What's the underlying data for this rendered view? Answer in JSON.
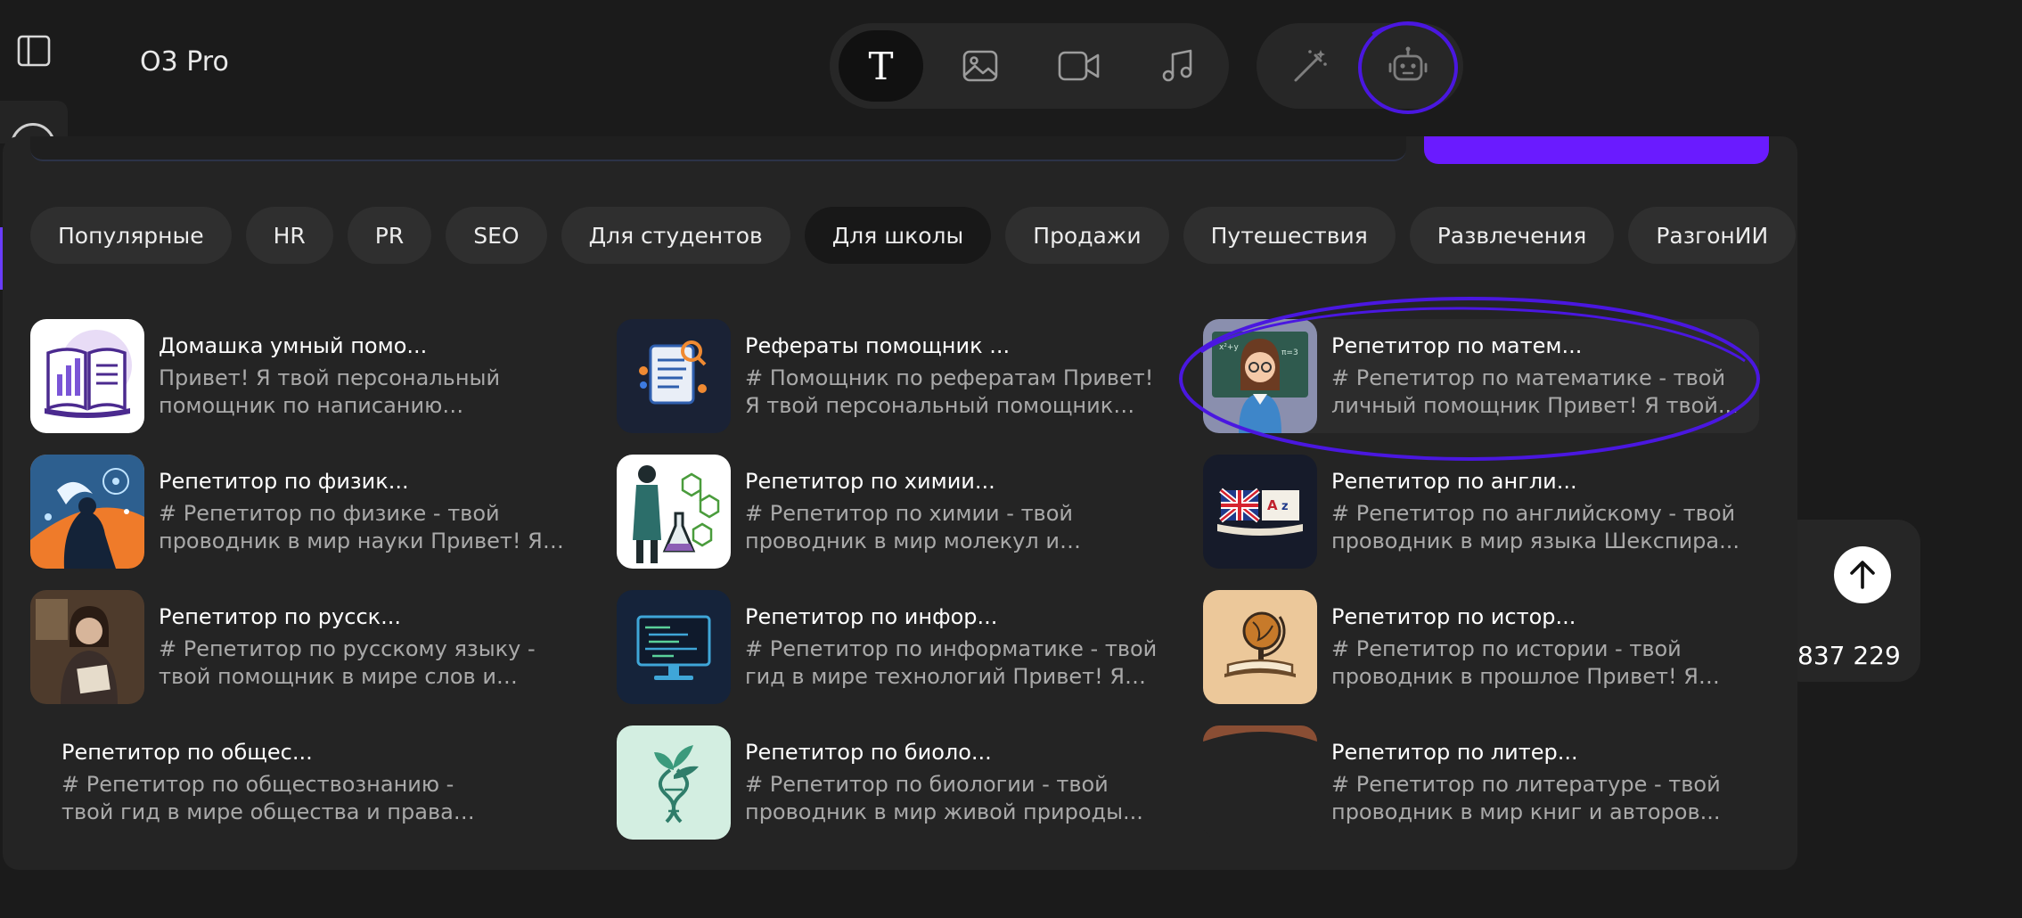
{
  "header": {
    "title": "O3 Pro"
  },
  "modes": [
    {
      "name": "text",
      "icon": "text-mode-icon",
      "active": true,
      "glyph": "T"
    },
    {
      "name": "image",
      "icon": "image-icon",
      "active": false
    },
    {
      "name": "video",
      "icon": "video-icon",
      "active": false
    },
    {
      "name": "music",
      "icon": "music-icon",
      "active": false
    }
  ],
  "tools": [
    {
      "name": "magic",
      "icon": "magic-wand-icon"
    },
    {
      "name": "bot",
      "icon": "robot-icon"
    }
  ],
  "side_widget": {
    "counter": "837 229"
  },
  "chips": [
    {
      "label": "Популярные",
      "active": false
    },
    {
      "label": "HR",
      "active": false
    },
    {
      "label": "PR",
      "active": false
    },
    {
      "label": "SEO",
      "active": false
    },
    {
      "label": "Для студентов",
      "active": false
    },
    {
      "label": "Для школы",
      "active": true
    },
    {
      "label": "Продажи",
      "active": false
    },
    {
      "label": "Путешествия",
      "active": false
    },
    {
      "label": "Развлечения",
      "active": false
    },
    {
      "label": "РазгонИИ",
      "active": false
    }
  ],
  "cards": [
    {
      "title": "Домашка умный помо...",
      "desc": "Привет! Я твой персональный помощник по написанию рефератов..."
    },
    {
      "title": "Рефераты помощник ...",
      "desc": "# Помощник по рефератам Привет! Я твой персональный помощник по..."
    },
    {
      "title": "Репетитор по матем...",
      "desc": "# Репетитор по математике - твой личный помощник Привет! Я твой..."
    },
    {
      "title": "Репетитор по физик...",
      "desc": "# Репетитор по физике - твой проводник в мир науки Привет! Я тво..."
    },
    {
      "title": "Репетитор по химии...",
      "desc": "# Репетитор по химии - твой проводник в мир молекул и реакций..."
    },
    {
      "title": "Репетитор по англи...",
      "desc": "# Репетитор по английскому - твой проводник в мир языка Шекспира..."
    },
    {
      "title": "Репетитор по русск...",
      "desc": "# Репетитор по русскому языку - твой помощник в мире слов и правил..."
    },
    {
      "title": "Репетитор по инфор...",
      "desc": "# Репетитор по информатике - твой гид в мире технологий Привет! Я тво..."
    },
    {
      "title": "Репетитор по истор...",
      "desc": "# Репетитор по истории - твой проводник в прошлое Привет! Я твой..."
    },
    {
      "title": "Репетитор по общес...",
      "desc": "# Репетитор по обществознанию - твой гид в мире общества и права Привет! Я твой..."
    },
    {
      "title": "Репетитор по биоло...",
      "desc": "# Репетитор по биологии - твой проводник в мир живой природы..."
    },
    {
      "title": "Репетитор по литер...",
      "desc": "# Репетитор по литературе - твой проводник в мир книг и авторов..."
    }
  ],
  "colors": {
    "background": "#1b1b1b",
    "panel": "#242424",
    "accent": "#6a1bff",
    "highlight_ink": "#4a17e0"
  }
}
